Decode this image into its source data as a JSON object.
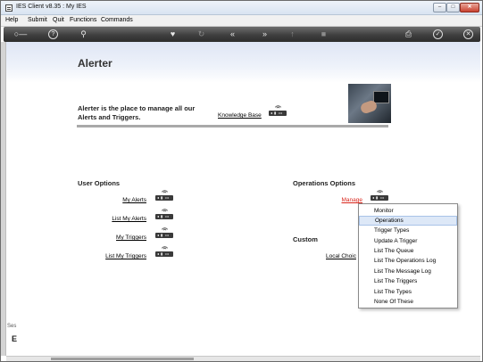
{
  "window": {
    "title": "IES Client v8.35 : My IES"
  },
  "menu": [
    "Help",
    "Submit",
    "Quit",
    "Functions",
    "Commands"
  ],
  "toolbar": {
    "icons": [
      "key-icon",
      "help-icon",
      "search-icon",
      "heart-icon",
      "history-icon",
      "rewind-icon",
      "fast-forward-icon",
      "upload-icon",
      "stop-icon",
      "print-icon",
      "check-icon",
      "close-icon"
    ]
  },
  "page": {
    "title": "Alerter",
    "intro": "Alerter is the place to manage all our Alerts and Triggers.",
    "knowledge_base": "Knowledge Base"
  },
  "user_options": {
    "title": "User Options",
    "links": [
      "My Alerts",
      "List My Alerts",
      "My Triggers",
      "List My Triggers"
    ]
  },
  "operations_options": {
    "title": "Operations Options",
    "manage": "Manage"
  },
  "custom": {
    "title": "Custom",
    "local_choices": "Local Choic"
  },
  "dropdown": {
    "items": [
      "Monitor",
      "Operations",
      "Trigger Types",
      "Update A Trigger",
      "List The Queue",
      "List The Operations Log",
      "List The Message Log",
      "List The Triggers",
      "List The Types",
      "None Of These"
    ],
    "highlighted": "Operations"
  },
  "left_edge": {
    "label": "Ses",
    "glyph": "E"
  }
}
